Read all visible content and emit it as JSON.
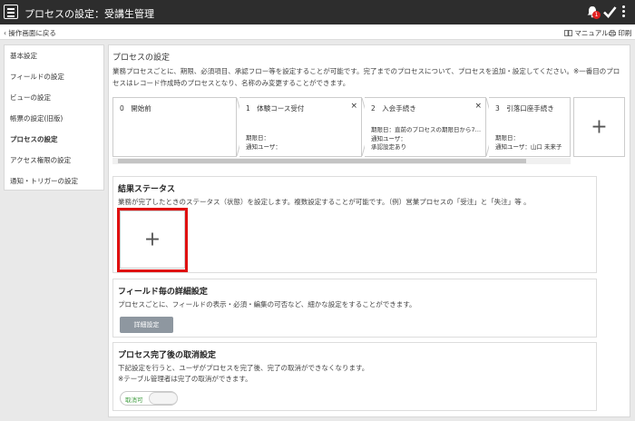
{
  "header": {
    "title": "プロセスの設定：受講生管理",
    "notification_count": "1"
  },
  "subbar": {
    "back_label": "操作画面に戻る",
    "manual_label": "マニュアル",
    "print_label": "印刷"
  },
  "sidebar": {
    "items": [
      {
        "label": "基本設定"
      },
      {
        "label": "フィールドの設定"
      },
      {
        "label": "ビューの設定"
      },
      {
        "label": "帳票の設定(旧版)"
      },
      {
        "label": "プロセスの設定"
      },
      {
        "label": "アクセス権限の設定"
      },
      {
        "label": "通知・トリガーの設定"
      }
    ]
  },
  "main": {
    "title": "プロセスの設定",
    "description": "業務プロセスごとに、期限、必須項目、承認フロー等を設定することが可能です。完了までのプロセスについて、プロセスを追加・設定してください。※一番目のプロセスはレコード作成時のプロセスとなり、名称のみ変更することができます。",
    "processes": [
      {
        "title": "0　開始前",
        "close": "",
        "details": []
      },
      {
        "title": "1　体験コース受付",
        "close": "×",
        "details": [
          "期限日：",
          "通知ユーザ："
        ]
      },
      {
        "title": "2　入会手続き",
        "close": "×",
        "details": [
          "期限日：直前のプロセスの期限日から7…",
          "通知ユーザ：",
          "承認設定あり"
        ]
      },
      {
        "title": "3　引落口座手続き",
        "close": "",
        "details": [
          "期限日：",
          "通知ユーザ：山口 未来子"
        ]
      }
    ],
    "add_process": "+"
  },
  "result_status": {
    "title": "結果ステータス",
    "description": "業務が完了したときのステータス（状態）を設定します。複数設定することが可能です。（例）営業プロセスの「受注」と「失注」等 。",
    "add": "+"
  },
  "field_detail": {
    "title": "フィールド毎の詳細設定",
    "description": "プロセスごとに、フィールドの表示・必須・編集の可否など、細かな設定をすることができます。",
    "button": "詳細設定"
  },
  "cancel_setting": {
    "title": "プロセス完了後の取消設定",
    "description_1": "下記設定を行うと、ユーザがプロセスを完了後、完了の取消ができなくなります。",
    "description_2": "※テーブル管理者は完了の取消ができます。",
    "toggle_label": "取消可"
  }
}
